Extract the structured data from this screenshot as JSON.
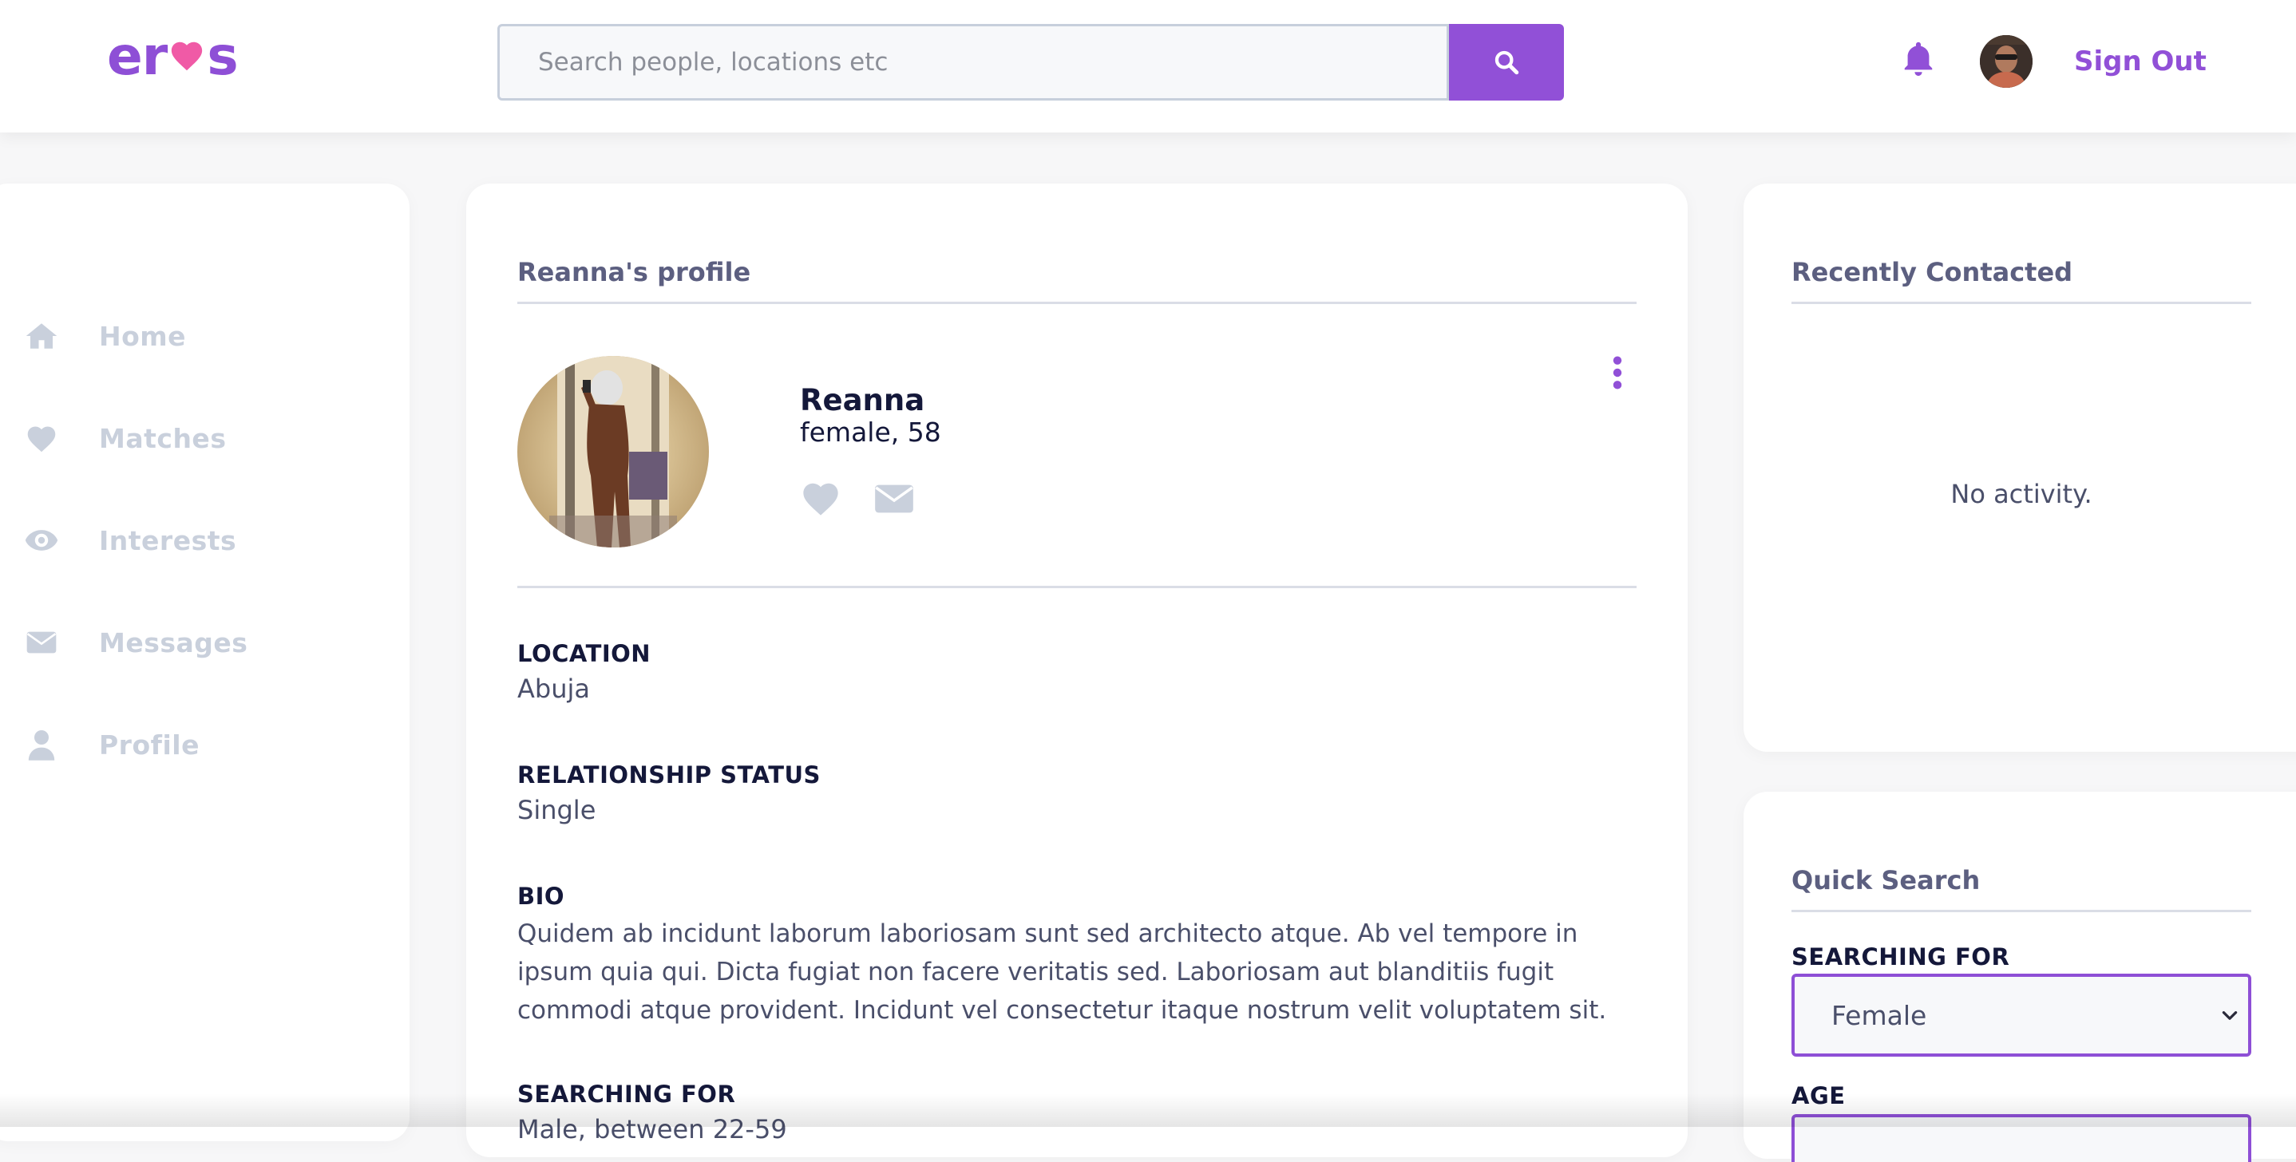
{
  "header": {
    "logo_text": {
      "left": "er",
      "right": "s"
    },
    "search": {
      "placeholder": "Search people, locations etc"
    },
    "sign_out_label": "Sign Out"
  },
  "sidebar": {
    "items": [
      {
        "label": "Home",
        "icon": "home-icon"
      },
      {
        "label": "Matches",
        "icon": "heart-icon"
      },
      {
        "label": "Interests",
        "icon": "eye-icon"
      },
      {
        "label": "Messages",
        "icon": "envelope-icon"
      },
      {
        "label": "Profile",
        "icon": "user-icon"
      }
    ]
  },
  "profile": {
    "title": "Reanna's profile",
    "name": "Reanna",
    "meta": "female, 58",
    "fields": {
      "location": {
        "label": "LOCATION",
        "value": "Abuja"
      },
      "relationship": {
        "label": "RELATIONSHIP STATUS",
        "value": "Single"
      },
      "bio": {
        "label": "BIO",
        "value": "Quidem ab incidunt laborum laboriosam sunt sed architecto atque. Ab vel tempore in ipsum quia qui. Dicta fugiat non facere veritatis sed. Laboriosam aut blanditiis fugit commodi atque provident. Incidunt vel consectetur itaque nostrum velit voluptatem sit."
      },
      "searching_for": {
        "label": "SEARCHING FOR",
        "value": "Male, between 22-59"
      }
    }
  },
  "recent": {
    "title": "Recently Contacted",
    "empty_text": "No activity."
  },
  "quick_search": {
    "title": "Quick Search",
    "searching_for_label": "SEARCHING FOR",
    "searching_for_value": "Female",
    "age_label": "AGE"
  },
  "colors": {
    "accent": "#9150d7",
    "logo_heart": "#f05aa6",
    "nav_inactive": "#c9d0dc",
    "heading": "#14183a"
  }
}
